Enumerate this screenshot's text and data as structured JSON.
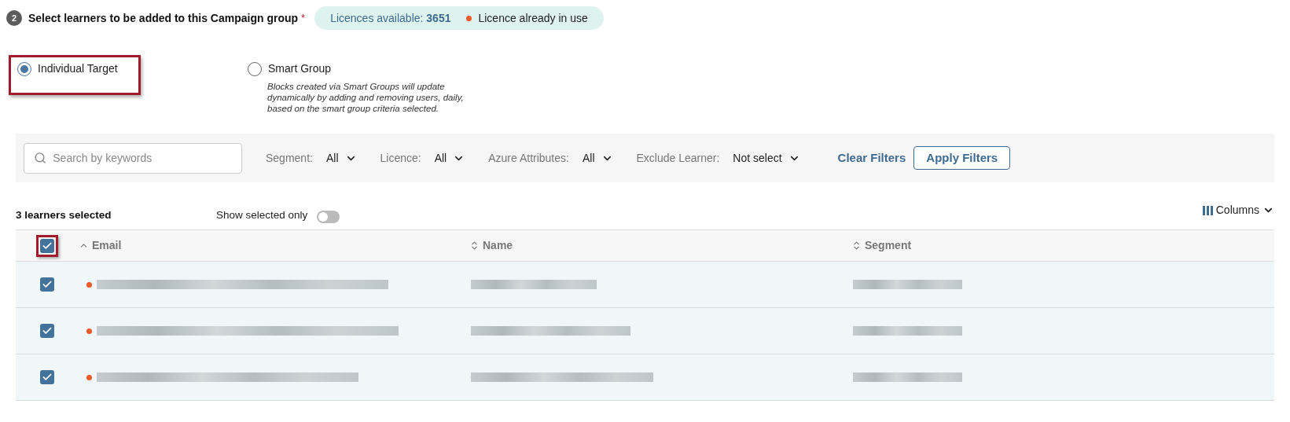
{
  "step": {
    "number": "2",
    "title": "Select learners to be added to this Campaign group",
    "required_mark": "*"
  },
  "licence_info": {
    "available_label": "Licences available:",
    "available_count": "3651",
    "legend": {
      "label": "Licence already in use",
      "color": "#f05a28"
    }
  },
  "target_options": [
    {
      "label": "Individual Target",
      "selected": true,
      "highlighted": true
    },
    {
      "label": "Smart Group",
      "selected": false,
      "highlighted": false,
      "description": "Blocks created via Smart Groups will update dynamically by adding and removing users, daily, based on the smart group criteria selected."
    }
  ],
  "filters": {
    "search": {
      "placeholder": "Search by keywords"
    },
    "dropdowns": [
      {
        "label": "Segment:",
        "value": "All"
      },
      {
        "label": "Licence:",
        "value": "All"
      },
      {
        "label": "Azure Attributes:",
        "value": "All"
      },
      {
        "label": "Exclude Learner:",
        "value": "Not select"
      }
    ],
    "clear_label": "Clear Filters",
    "apply_label": "Apply Filters"
  },
  "selection_summary": "3 learners selected",
  "show_selected_only": {
    "label": "Show selected only",
    "on": false
  },
  "columns_button": "Columns",
  "table": {
    "select_all": {
      "checked": true,
      "highlighted": true
    },
    "columns": [
      {
        "label": "Email",
        "sorted": true
      },
      {
        "label": "Name",
        "sorted": false
      },
      {
        "label": "Segment",
        "sorted": false
      }
    ],
    "rows": [
      {
        "selected": true,
        "licence_in_use": true
      },
      {
        "selected": true,
        "licence_in_use": true
      },
      {
        "selected": true,
        "licence_in_use": true
      }
    ]
  }
}
